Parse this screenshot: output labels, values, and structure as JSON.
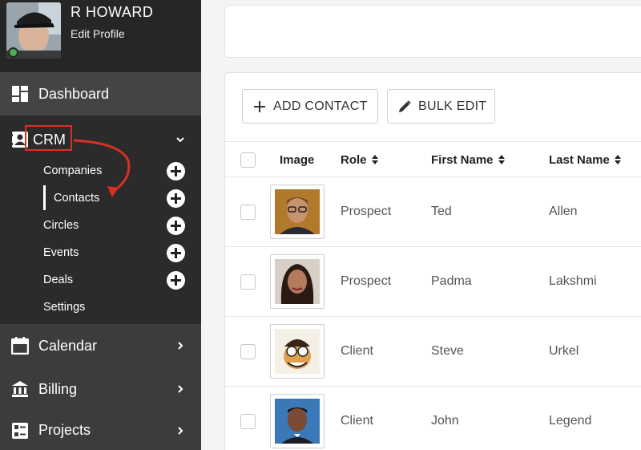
{
  "profile": {
    "name": "R HOWARD",
    "edit_label": "Edit Profile"
  },
  "nav": {
    "dashboard": "Dashboard",
    "crm": "CRM",
    "crm_sub": [
      {
        "label": "Companies",
        "has_add": true
      },
      {
        "label": "Contacts",
        "has_add": true,
        "active": true
      },
      {
        "label": "Circles",
        "has_add": true
      },
      {
        "label": "Events",
        "has_add": true
      },
      {
        "label": "Deals",
        "has_add": true
      },
      {
        "label": "Settings",
        "has_add": false
      }
    ],
    "calendar": "Calendar",
    "billing": "Billing",
    "projects": "Projects"
  },
  "toolbar": {
    "add_contact": "ADD CONTACT",
    "bulk_edit": "BULK EDIT"
  },
  "table": {
    "headers": {
      "image": "Image",
      "role": "Role",
      "first_name": "First Name",
      "last_name": "Last Name"
    },
    "rows": [
      {
        "role": "Prospect",
        "first_name": "Ted",
        "last_name": "Allen"
      },
      {
        "role": "Prospect",
        "first_name": "Padma",
        "last_name": "Lakshmi"
      },
      {
        "role": "Client",
        "first_name": "Steve",
        "last_name": "Urkel"
      },
      {
        "role": "Client",
        "first_name": "John",
        "last_name": "Legend"
      }
    ]
  },
  "colors": {
    "sidebar": "#2b2b2b",
    "highlight": "#d93025",
    "status": "#4caf50"
  }
}
